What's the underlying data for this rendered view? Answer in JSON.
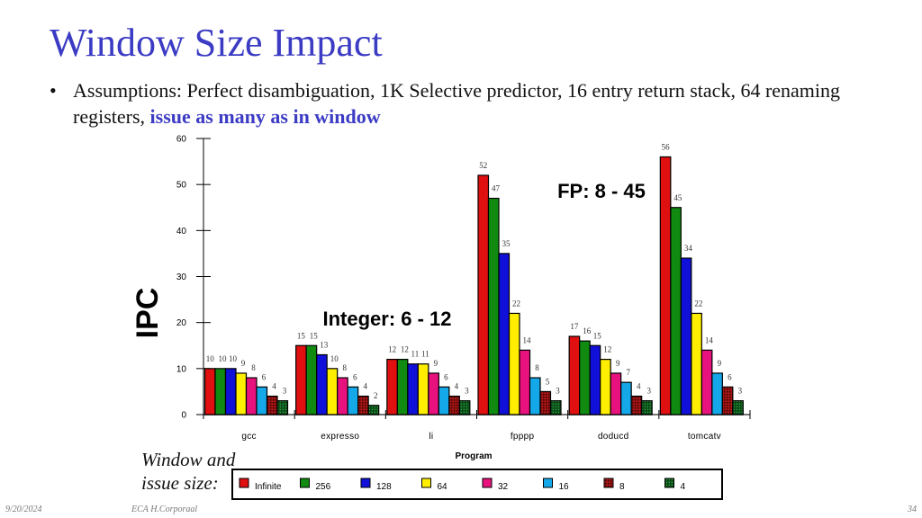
{
  "slide": {
    "title": "Window Size Impact",
    "bullet_marker": "•",
    "bullet_text": "Assumptions: Perfect disambiguation, 1K Selective predictor, 16 entry return stack, 64 renaming registers, ",
    "bullet_highlight": "issue as many as in window",
    "legend_caption_line1": "Window and",
    "legend_caption_line2": "issue size:",
    "footer_date": "9/20/2024",
    "footer_author": "ECA  H.Corporaal",
    "footer_page": "34"
  },
  "chart_data": {
    "type": "bar",
    "title": "",
    "xlabel": "Program",
    "ylabel": "IPC",
    "ylim": [
      0,
      60
    ],
    "yticks": [
      0,
      10,
      20,
      30,
      40,
      50,
      60
    ],
    "grid": false,
    "legend_position": "bottom",
    "categories": [
      "gcc",
      "espresso",
      "li",
      "fpppp",
      "doducd",
      "tomcatv"
    ],
    "category_display": [
      "gcc",
      "expresso",
      "li",
      "fpppp",
      "doducd",
      "tomcatv"
    ],
    "series": [
      {
        "name": "Infinite",
        "color": "#e01010",
        "pattern": "solid",
        "values": [
          10,
          15,
          12,
          52,
          17,
          56
        ]
      },
      {
        "name": "256",
        "color": "#108a10",
        "pattern": "solid",
        "values": [
          10,
          15,
          12,
          47,
          16,
          45
        ]
      },
      {
        "name": "128",
        "color": "#1010d8",
        "pattern": "solid",
        "values": [
          10,
          13,
          11,
          35,
          15,
          34
        ]
      },
      {
        "name": "64",
        "color": "#ffee00",
        "pattern": "solid",
        "values": [
          9,
          10,
          11,
          22,
          12,
          22
        ]
      },
      {
        "name": "32",
        "color": "#e8127e",
        "pattern": "solid",
        "values": [
          8,
          8,
          9,
          14,
          9,
          14
        ]
      },
      {
        "name": "16",
        "color": "#14a8e8",
        "pattern": "solid",
        "values": [
          6,
          6,
          6,
          8,
          7,
          9
        ]
      },
      {
        "name": "8",
        "color": "#8a1010",
        "pattern": "hatched",
        "values": [
          4,
          4,
          4,
          5,
          4,
          6
        ]
      },
      {
        "name": "4",
        "color": "#0e5a1e",
        "pattern": "hatched",
        "values": [
          3,
          2,
          3,
          3,
          3,
          3
        ]
      }
    ],
    "annotations": [
      {
        "text": "Integer: 6 - 12"
      },
      {
        "text": "FP: 8 - 45"
      }
    ]
  }
}
